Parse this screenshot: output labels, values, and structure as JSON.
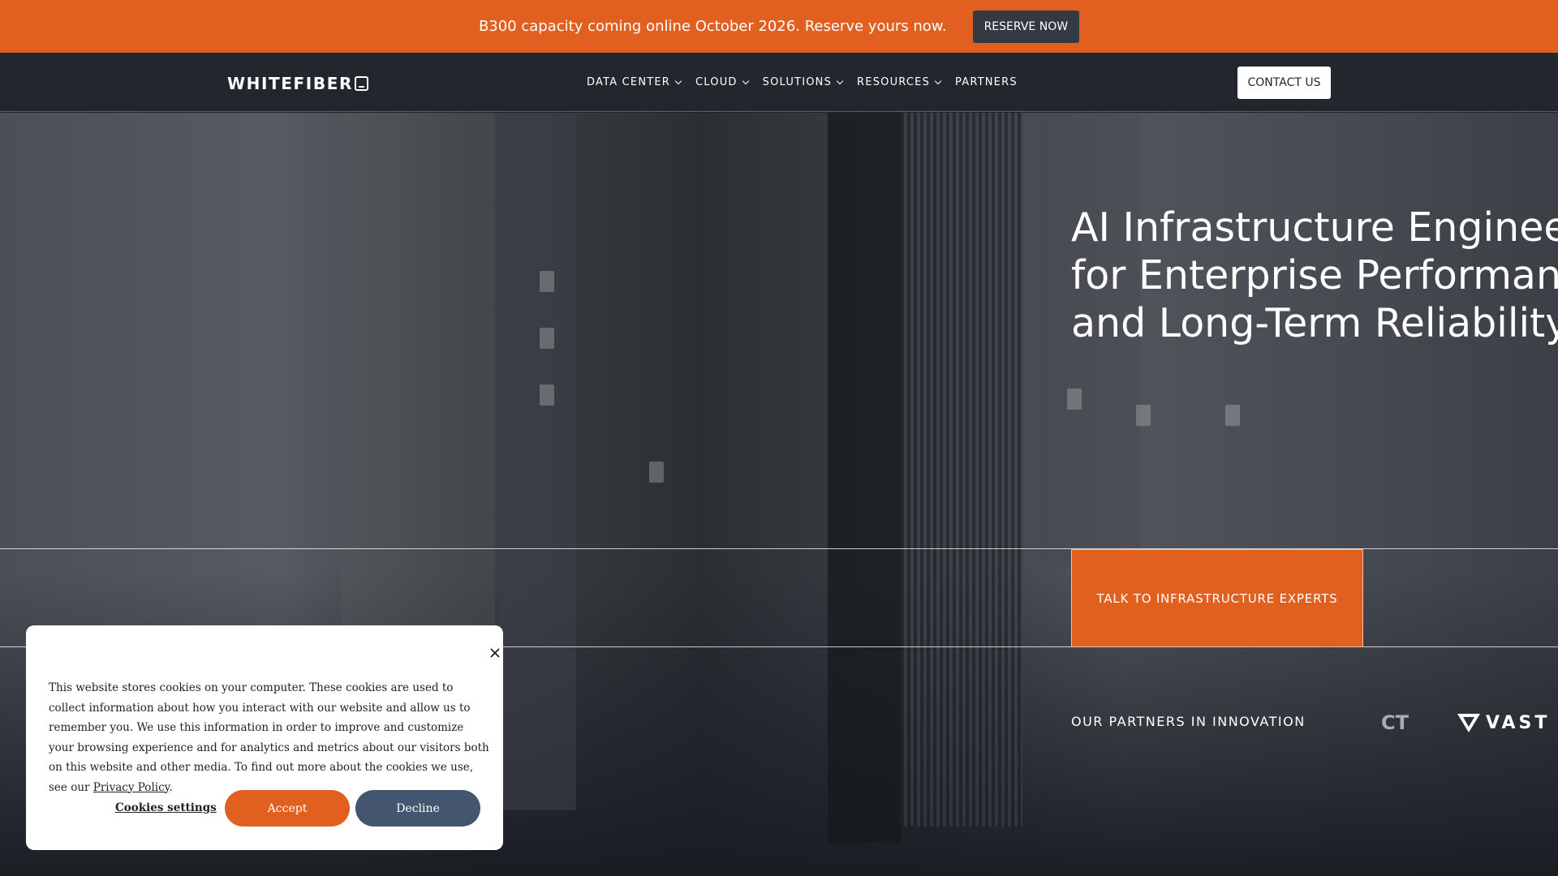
{
  "announcement": {
    "text": "B300 capacity coming online October 2026. Reserve yours now.",
    "button_label": "RESERVE NOW"
  },
  "header": {
    "logo_text": "WHITEFIBER",
    "nav": [
      {
        "label": "DATA CENTER",
        "has_dropdown": true
      },
      {
        "label": "CLOUD",
        "has_dropdown": true
      },
      {
        "label": "SOLUTIONS",
        "has_dropdown": true
      },
      {
        "label": "RESOURCES",
        "has_dropdown": true
      },
      {
        "label": "PARTNERS",
        "has_dropdown": false
      }
    ],
    "contact_label": "CONTACT US"
  },
  "hero": {
    "title_lines": [
      "AI Infrastructure Engineer",
      "for Enterprise Performanc",
      "and Long-Term Reliability"
    ],
    "cta_label": "TALK TO INFRASTRUCTURE EXPERTS",
    "partners_label": "OUR PARTNERS IN INNOVATION",
    "partner_logos": [
      {
        "text": "CT",
        "icon": "partner-logo-partial"
      },
      {
        "text": "VAST",
        "icon": "vast-v-icon"
      }
    ]
  },
  "cookie": {
    "text": "This website stores cookies on your computer. These cookies are used to collect information about how you interact with our website and allow us to remember you. We use this information in order to improve and customize your browsing experience and for analytics and metrics about our visitors both on this website and other media. To find out more about the cookies we use, see our ",
    "link_text": "Privacy Policy",
    "text_end": ".",
    "settings_label": "Cookies settings",
    "accept_label": "Accept",
    "decline_label": "Decline"
  },
  "colors": {
    "accent": "#e2601f",
    "header_bg": "#22272e",
    "decline_bg": "#44566f",
    "reserve_bg": "#333a44"
  }
}
